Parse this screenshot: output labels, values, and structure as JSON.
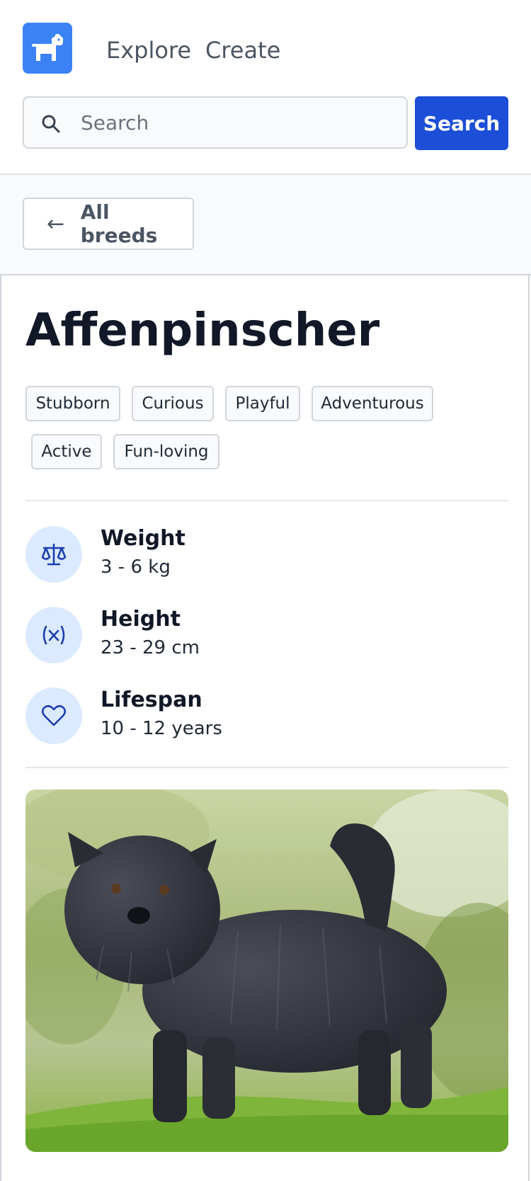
{
  "nav": {
    "logo_icon": "dog-icon",
    "links": [
      "Explore",
      "Create"
    ]
  },
  "search": {
    "placeholder": "Search",
    "value": "",
    "button_label": "Search"
  },
  "back_button": {
    "arrow": "←",
    "label": "All breeds"
  },
  "breed": {
    "name": "Affenpinscher",
    "tags": [
      "Stubborn",
      "Curious",
      "Playful",
      "Adventurous",
      "Active",
      "Fun-loving"
    ],
    "stats": [
      {
        "icon": "scale-icon",
        "label": "Weight",
        "value": "3 - 6 kg"
      },
      {
        "icon": "variable-icon",
        "label": "Height",
        "value": "23 - 29 cm"
      },
      {
        "icon": "heart-icon",
        "label": "Lifespan",
        "value": "10 - 12 years"
      }
    ]
  },
  "colors": {
    "accent": "#1d4ed8",
    "logo_bg": "#3b82f6",
    "icon_bg": "#dbeafe"
  }
}
